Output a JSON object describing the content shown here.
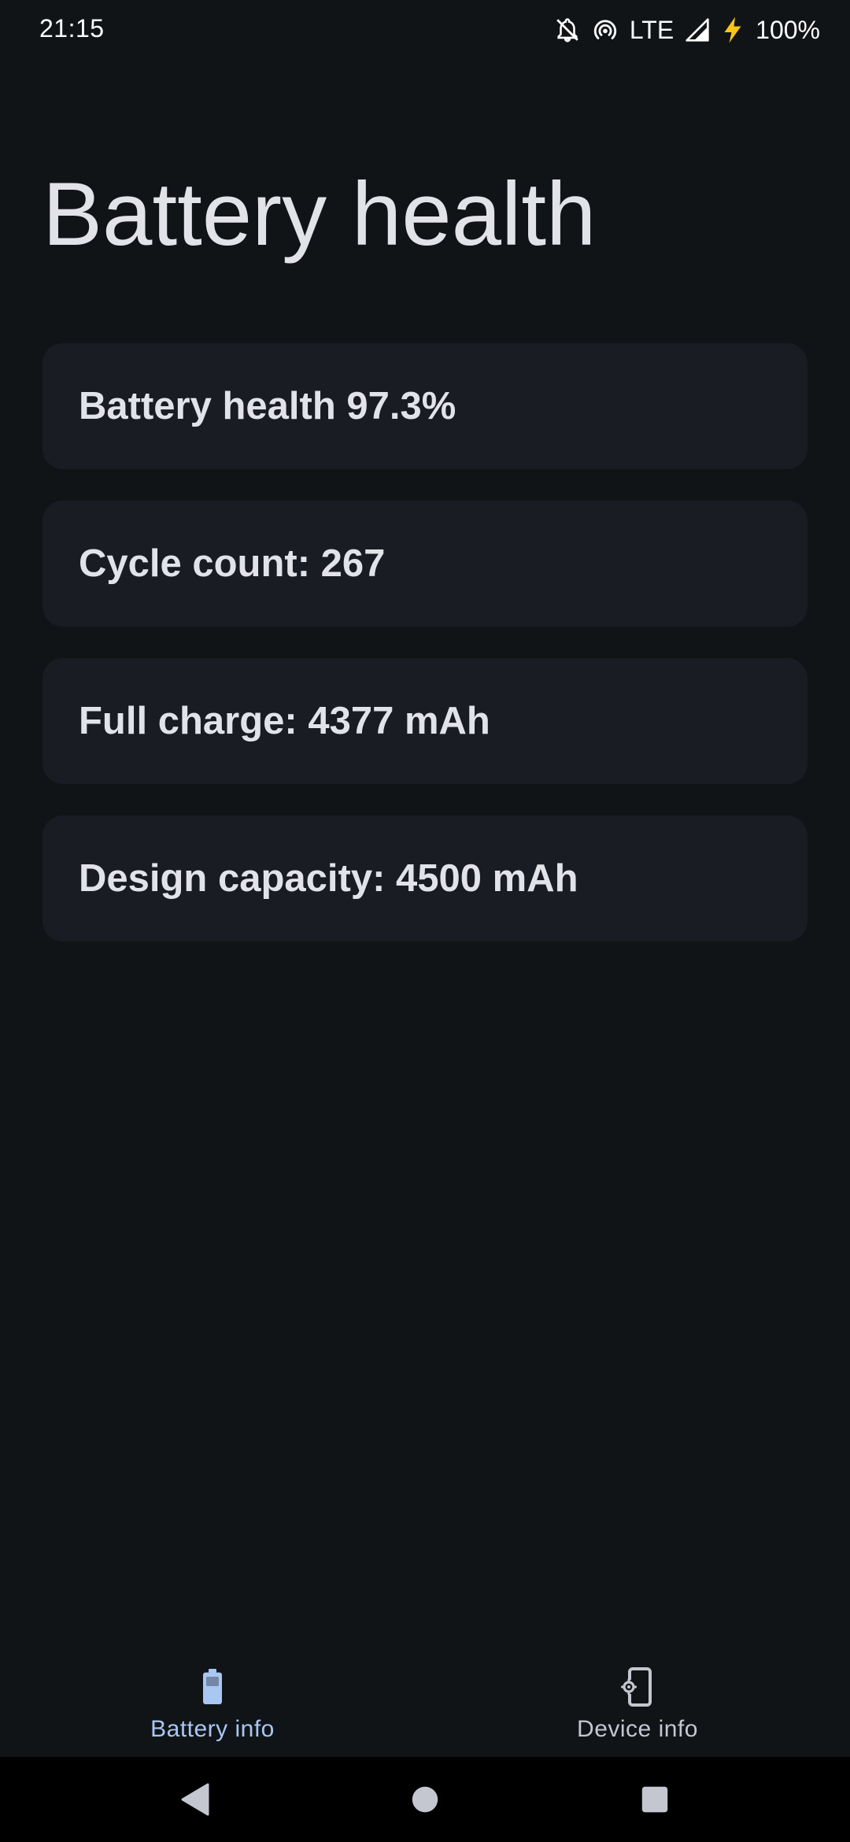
{
  "status_bar": {
    "time": "21:15",
    "network": "LTE",
    "battery_percent": "100%",
    "icons": [
      "notifications-off-icon",
      "hotspot-icon",
      "signal-icon",
      "charging-bolt-icon"
    ],
    "charging_color": "#f5c518"
  },
  "page": {
    "title": "Battery health"
  },
  "cards": [
    {
      "text": "Battery health 97.3%"
    },
    {
      "text": "Cycle count: 267"
    },
    {
      "text": "Full charge: 4377 mAh"
    },
    {
      "text": "Design capacity: 4500 mAh"
    }
  ],
  "bottom_nav": {
    "items": [
      {
        "label": "Battery info",
        "icon": "battery-icon",
        "selected": true
      },
      {
        "label": "Device info",
        "icon": "device-settings-icon",
        "selected": false
      }
    ],
    "accent_color": "#a9c7f3"
  },
  "system_nav": {
    "icons": [
      "back-icon",
      "home-icon",
      "recents-icon"
    ]
  }
}
